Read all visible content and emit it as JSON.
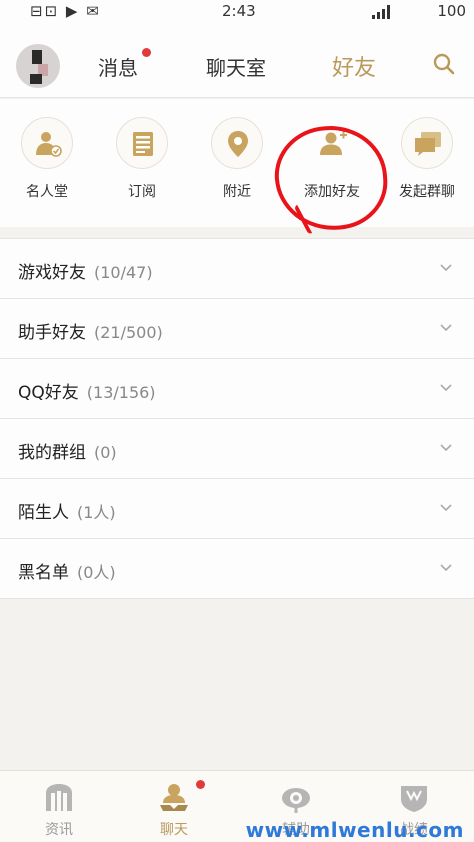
{
  "status_bar": {
    "left_text": "⊟⊡ ▶ ✉",
    "time": "2:43",
    "battery": "100"
  },
  "header": {
    "tabs": [
      {
        "label": "消息",
        "has_badge": true
      },
      {
        "label": "聊天室",
        "has_badge": false
      },
      {
        "label": "好友",
        "active": true
      }
    ],
    "search_icon": "search-icon"
  },
  "quick_actions": [
    {
      "label": "名人堂",
      "icon": "hall-of-fame-icon"
    },
    {
      "label": "订阅",
      "icon": "subscribe-icon"
    },
    {
      "label": "附近",
      "icon": "location-pin-icon"
    },
    {
      "label": "添加好友",
      "icon": "add-friend-icon",
      "annotated": true
    },
    {
      "label": "发起群聊",
      "icon": "group-chat-icon"
    }
  ],
  "friend_groups": [
    {
      "name": "游戏好友",
      "count": "(10/47)"
    },
    {
      "name": "助手好友",
      "count": "(21/500)"
    },
    {
      "name": "QQ好友",
      "count": "(13/156)"
    },
    {
      "name": "我的群组",
      "count": "(0)"
    },
    {
      "name": "陌生人",
      "count": "(1人)"
    },
    {
      "name": "黑名单",
      "count": "(0人)"
    }
  ],
  "bottom_nav": [
    {
      "label": "资讯",
      "icon": "news-icon"
    },
    {
      "label": "聊天",
      "icon": "chat-icon",
      "active": true,
      "has_badge": true
    },
    {
      "label": "辅助",
      "icon": "assist-icon"
    },
    {
      "label": "战绩",
      "icon": "record-icon"
    }
  ],
  "watermark": "www.mlwenlu.com",
  "colors": {
    "accent": "#b9995c",
    "badge": "#e03a3a",
    "annotation": "#e8141a",
    "background": "#f3f2ee"
  }
}
